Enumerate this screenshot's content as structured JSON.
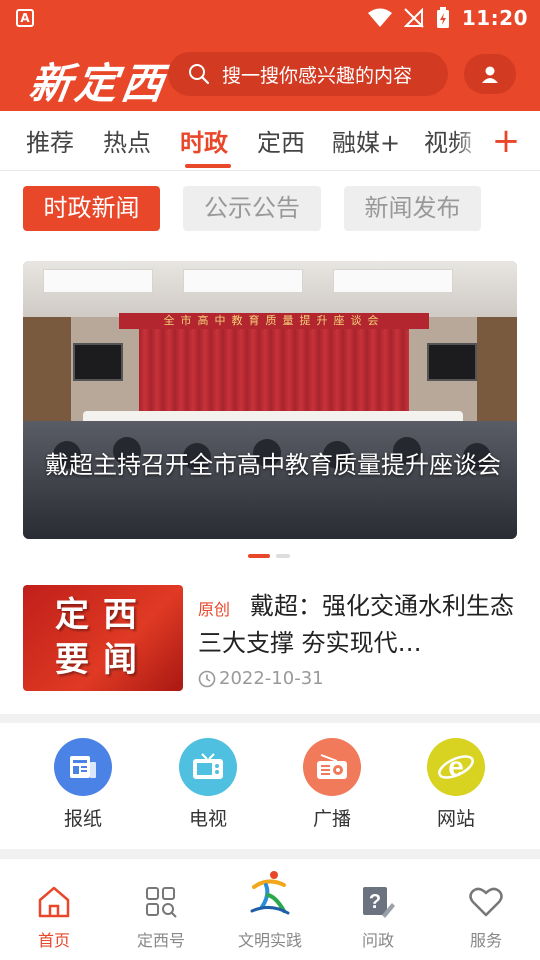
{
  "status_bar": {
    "time": "11:20",
    "app_icon": "A"
  },
  "header": {
    "logo": "新定西",
    "search_placeholder": "搜一搜你感兴趣的内容"
  },
  "tabs": [
    {
      "label": "推荐"
    },
    {
      "label": "热点"
    },
    {
      "label": "时政",
      "active": true
    },
    {
      "label": "定西"
    },
    {
      "label": "融媒+"
    },
    {
      "label": "视频"
    }
  ],
  "subtabs": [
    {
      "label": "时政新闻",
      "active": true
    },
    {
      "label": "公示公告"
    },
    {
      "label": "新闻发布"
    }
  ],
  "banner": {
    "caption": "戴超主持召开全市高中教育质量提升座谈会",
    "sign": "全市高中教育质量提升座谈会",
    "active_slide": 1,
    "slide_count": 2
  },
  "news": {
    "tag": "原创",
    "title": "戴超：强化交通水利生态三大支撑  夯实现代…",
    "date": "2022-10-31",
    "thumb_line1": "定西",
    "thumb_line2": "要闻"
  },
  "quick_links": [
    {
      "label": "报纸",
      "icon": "newspaper-icon",
      "color": "#4a82e6"
    },
    {
      "label": "电视",
      "icon": "tv-icon",
      "color": "#4fc0df"
    },
    {
      "label": "广播",
      "icon": "radio-icon",
      "color": "#f07a5a"
    },
    {
      "label": "网站",
      "icon": "browser-e-icon",
      "color": "#d8d220"
    }
  ],
  "bottom_nav": [
    {
      "label": "首页",
      "icon": "home-icon",
      "active": true
    },
    {
      "label": "定西号",
      "icon": "grid-search-icon"
    },
    {
      "label": "文明实践",
      "icon": "civilization-practice-logo"
    },
    {
      "label": "问政",
      "icon": "question-edit-icon"
    },
    {
      "label": "服务",
      "icon": "heart-icon"
    }
  ],
  "colors": {
    "brand": "#e8472a",
    "inactive_tab": "#444444",
    "muted": "#999999"
  }
}
